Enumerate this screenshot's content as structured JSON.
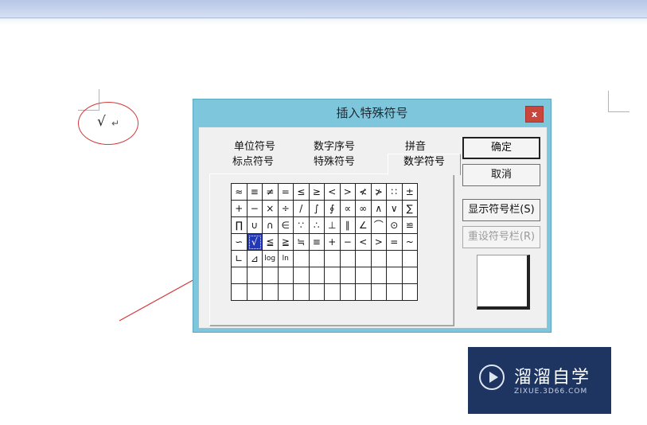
{
  "document": {
    "check_glyph": "√",
    "return_glyph": "↵"
  },
  "dialog": {
    "title": "插入特殊符号",
    "close_label": "x",
    "tabs_row1": [
      "单位符号",
      "数字序号",
      "拼音"
    ],
    "tabs_row2": [
      "标点符号",
      "特殊符号"
    ],
    "active_tab": "数学符号",
    "symbols": [
      [
        "≈",
        "≡",
        "≠",
        "=",
        "≤",
        "≥",
        "<",
        ">",
        "≮",
        "≯",
        "∷",
        "±"
      ],
      [
        "+",
        "−",
        "×",
        "÷",
        "/",
        "∫",
        "∮",
        "∝",
        "∞",
        "∧",
        "∨",
        "∑"
      ],
      [
        "∏",
        "∪",
        "∩",
        "∈",
        "∵",
        "∴",
        "⊥",
        "∥",
        "∠",
        "⌒",
        "⊙",
        "≌"
      ],
      [
        "∽",
        "√",
        "≦",
        "≧",
        "≒",
        "≡",
        "+",
        "−",
        "<",
        ">",
        "=",
        "~"
      ],
      [
        "∟",
        "⊿",
        "log",
        "ln",
        "",
        "",
        "",
        "",
        "",
        "",
        "",
        "",
        ""
      ],
      [
        "",
        "",
        "",
        "",
        "",
        "",
        "",
        "",
        "",
        "",
        "",
        "",
        ""
      ],
      [
        "",
        "",
        "",
        "",
        "",
        "",
        "",
        "",
        "",
        "",
        "",
        "",
        ""
      ]
    ],
    "selected_symbol": "√",
    "buttons": {
      "ok": "确定",
      "cancel": "取消",
      "show_bar": "显示符号栏(S)",
      "reset_bar": "重设符号栏(R)"
    }
  },
  "watermark": {
    "title": "溜溜自学",
    "url": "ZIXUE.3D66.COM"
  },
  "colors": {
    "dialog_frame": "#7ec6dc",
    "selected_cell": "#2438b5",
    "annotation_red": "#d23a3a",
    "watermark_bg": "#1d3560"
  }
}
